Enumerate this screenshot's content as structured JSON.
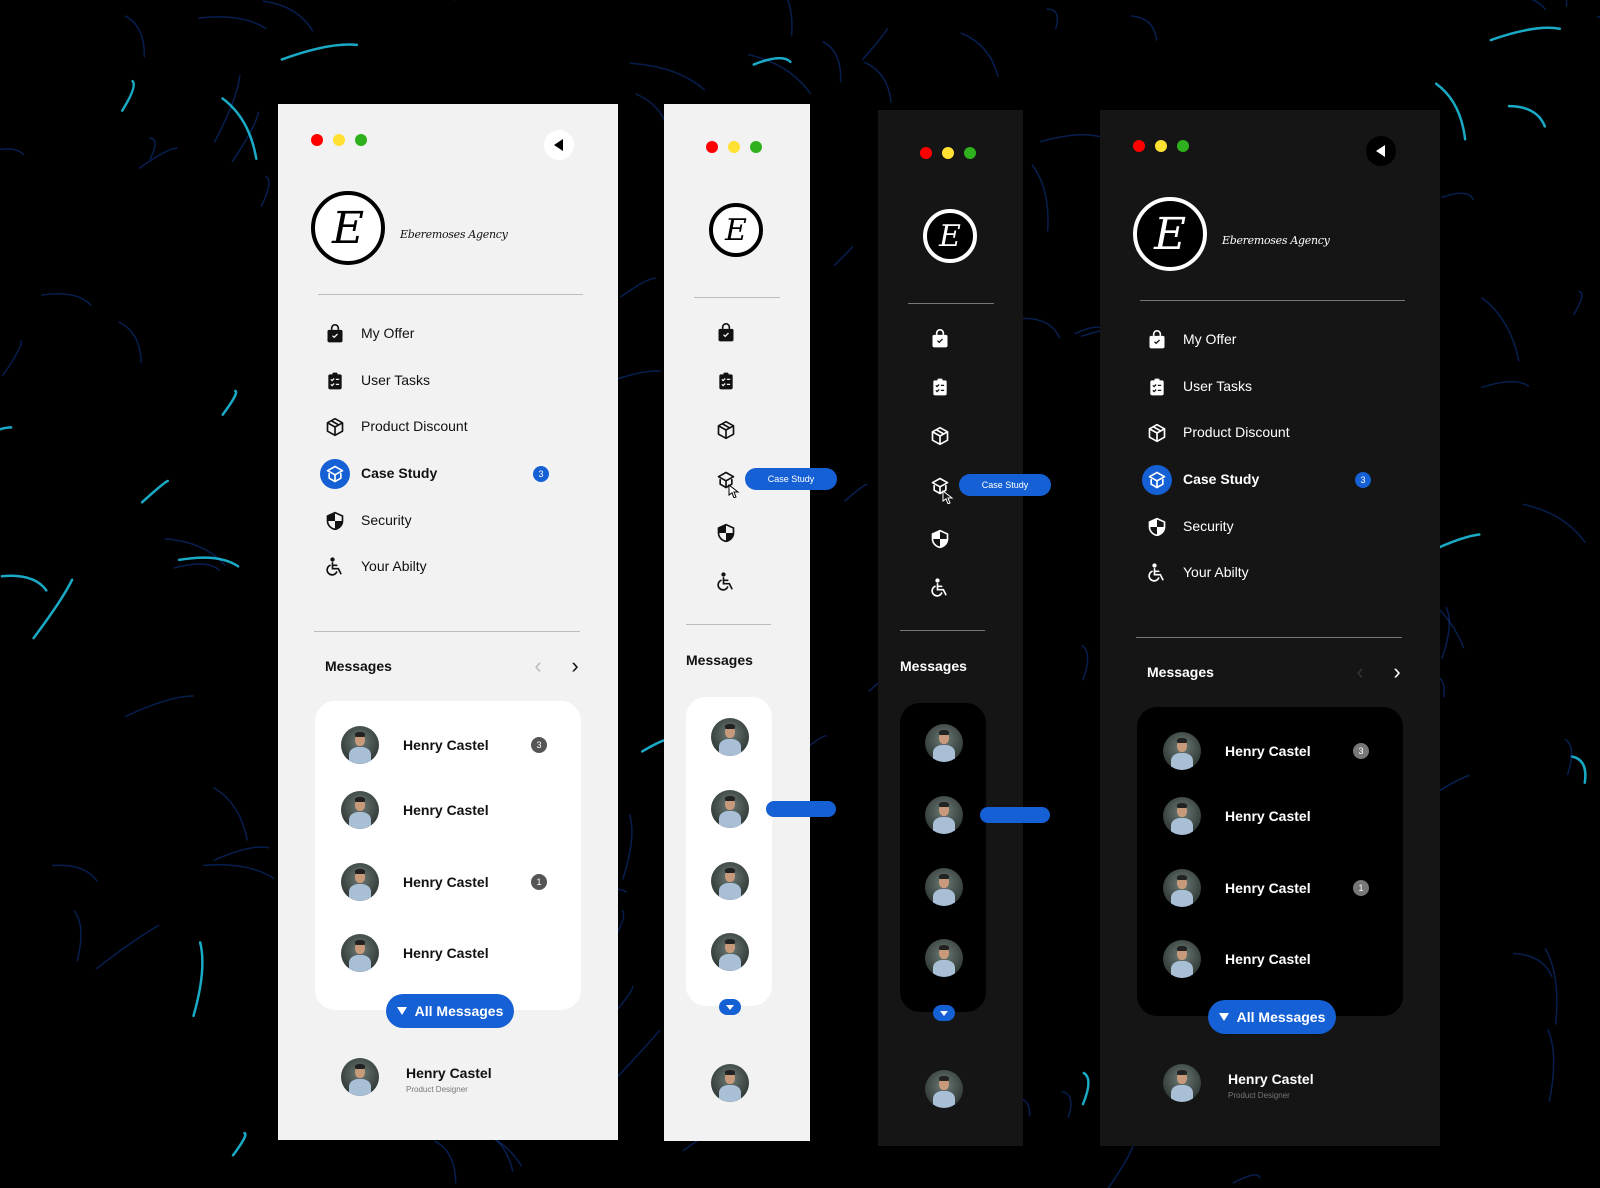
{
  "window_controls": {
    "close": "#ff0000",
    "minimize": "#ffe033",
    "maximize": "#2fb11d"
  },
  "accent": "#1560d4",
  "brand": {
    "logo_letter": "E",
    "name": "Eberemoses Agency"
  },
  "menu": [
    {
      "label": "My Offer",
      "icon": "shopping-bag-check-icon"
    },
    {
      "label": "User Tasks",
      "icon": "clipboard-tasks-icon"
    },
    {
      "label": "Product Discount",
      "icon": "box-icon"
    },
    {
      "label": "Case Study",
      "icon": "open-box-icon",
      "badge": "3",
      "active": true
    },
    {
      "label": "Security",
      "icon": "shield-icon"
    },
    {
      "label": "Your Abilty",
      "icon": "wheelchair-icon"
    }
  ],
  "tooltip": "Case Study",
  "messages": {
    "title": "Messages",
    "items": [
      {
        "name": "Henry Castel",
        "badge": "3"
      },
      {
        "name": "Henry Castel"
      },
      {
        "name": "Henry Castel",
        "badge": "1"
      },
      {
        "name": "Henry Castel"
      }
    ],
    "all_label": "All Messages"
  },
  "profile": {
    "name": "Henry Castel",
    "role": "Product Designer"
  }
}
